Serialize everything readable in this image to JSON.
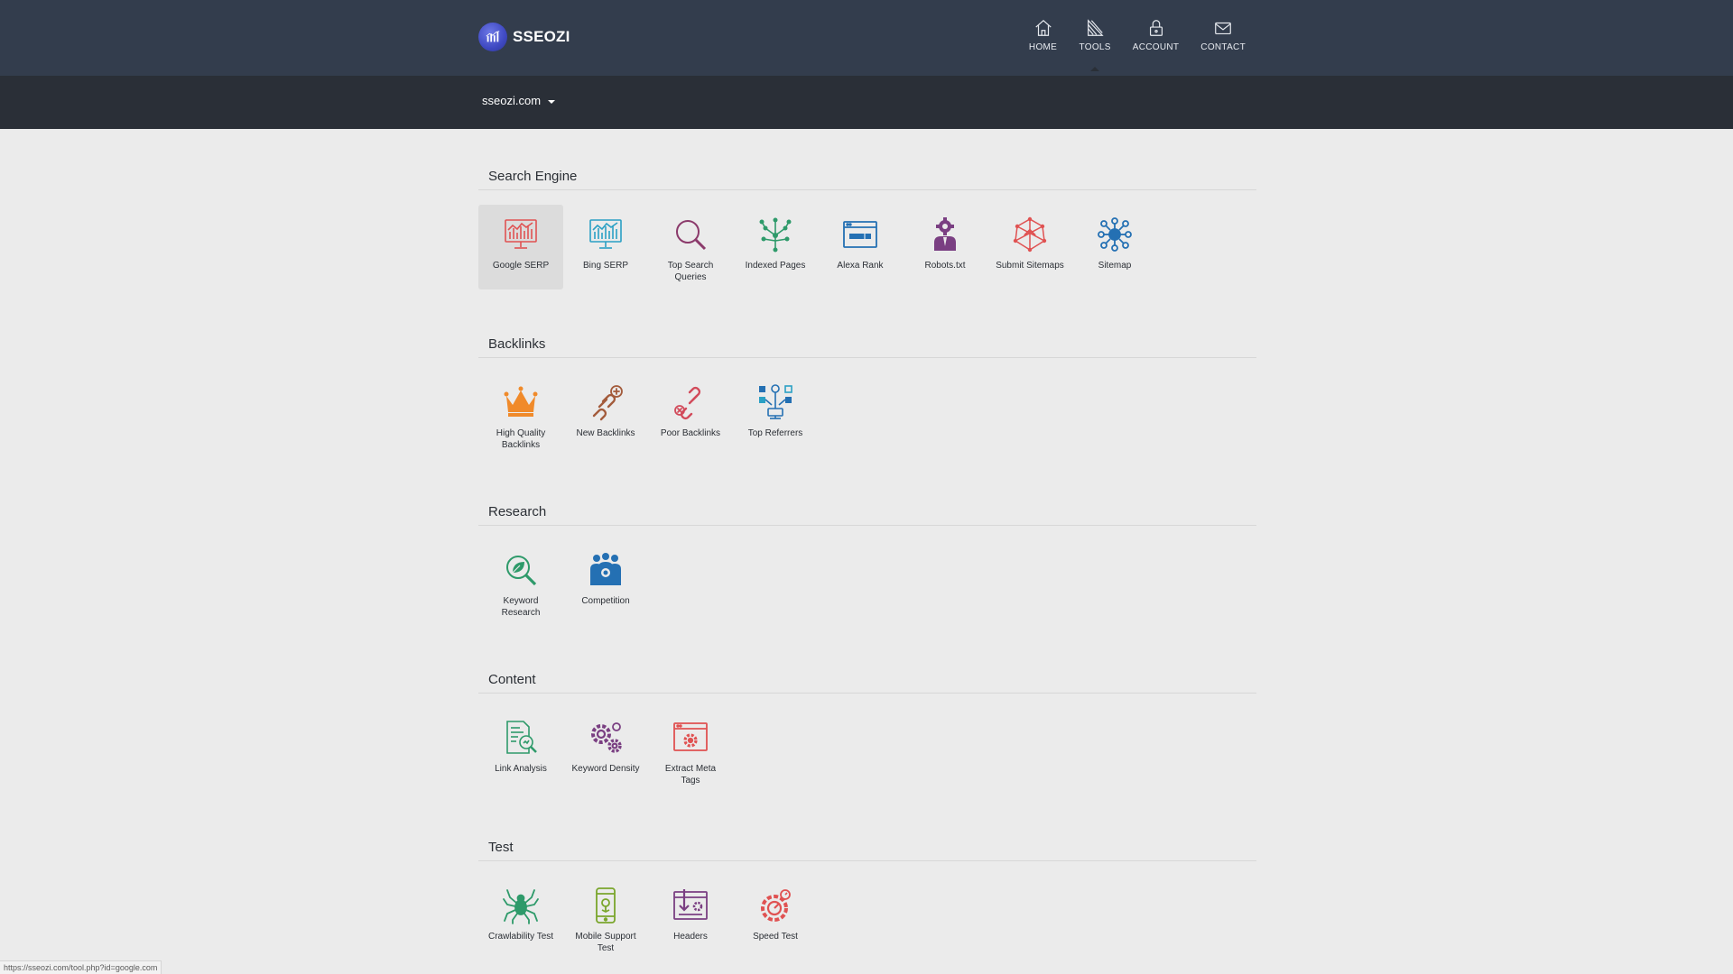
{
  "header": {
    "brand": "SSEOZI",
    "nav": [
      {
        "label": "HOME",
        "icon": "home-icon"
      },
      {
        "label": "TOOLS",
        "icon": "tools-icon"
      },
      {
        "label": "ACCOUNT",
        "icon": "lock-icon"
      },
      {
        "label": "CONTACT",
        "icon": "envelope-icon"
      }
    ],
    "active_nav": "TOOLS"
  },
  "domain": {
    "selected": "sseozi.com"
  },
  "sections": [
    {
      "title": "Search Engine",
      "tools": [
        {
          "label": "Google SERP",
          "icon": "serp-chart-icon",
          "color": "#e05252"
        },
        {
          "label": "Bing SERP",
          "icon": "serp-chart-icon",
          "color": "#2aa0c4"
        },
        {
          "label": "Top Search Queries",
          "icon": "magnifier-icon",
          "color": "#8b3a6b"
        },
        {
          "label": "Indexed Pages",
          "icon": "network-tree-icon",
          "color": "#2e9a6a"
        },
        {
          "label": "Alexa Rank",
          "icon": "browser-window-icon",
          "color": "#2470b3"
        },
        {
          "label": "Robots.txt",
          "icon": "robot-person-icon",
          "color": "#7a3f82"
        },
        {
          "label": "Submit Sitemaps",
          "icon": "upload-network-icon",
          "color": "#e05252"
        },
        {
          "label": "Sitemap",
          "icon": "hub-nodes-icon",
          "color": "#2470b3"
        }
      ]
    },
    {
      "title": "Backlinks",
      "tools": [
        {
          "label": "High Quality Backlinks",
          "icon": "crown-icon",
          "color": "#f08a2a"
        },
        {
          "label": "New Backlinks",
          "icon": "chain-plus-icon",
          "color": "#a35b3b"
        },
        {
          "label": "Poor Backlinks",
          "icon": "chain-broken-icon",
          "color": "#d24a5a"
        },
        {
          "label": "Top Referrers",
          "icon": "social-referrers-icon",
          "color": "#2470b3"
        }
      ]
    },
    {
      "title": "Research",
      "tools": [
        {
          "label": "Keyword Research",
          "icon": "leaf-search-icon",
          "color": "#2e9a6a"
        },
        {
          "label": "Competition",
          "icon": "group-people-icon",
          "color": "#2470b3"
        }
      ]
    },
    {
      "title": "Content",
      "tools": [
        {
          "label": "Link Analysis",
          "icon": "document-search-icon",
          "color": "#2e9a6a"
        },
        {
          "label": "Keyword Density",
          "icon": "gears-icon",
          "color": "#7a3f82"
        },
        {
          "label": "Extract Meta Tags",
          "icon": "browser-gear-icon",
          "color": "#e05252"
        }
      ]
    },
    {
      "title": "Test",
      "tools": [
        {
          "label": "Crawlability Test",
          "icon": "spider-icon",
          "color": "#2e9a6a"
        },
        {
          "label": "Mobile Support Test",
          "icon": "mobile-icon",
          "color": "#7aa62c"
        },
        {
          "label": "Headers",
          "icon": "browser-download-icon",
          "color": "#7a3f82"
        },
        {
          "label": "Speed Test",
          "icon": "speed-gear-icon",
          "color": "#e05252"
        }
      ]
    }
  ],
  "selected_tool": "Google SERP",
  "status_url": "https://sseozi.com/tool.php?id=google.com"
}
